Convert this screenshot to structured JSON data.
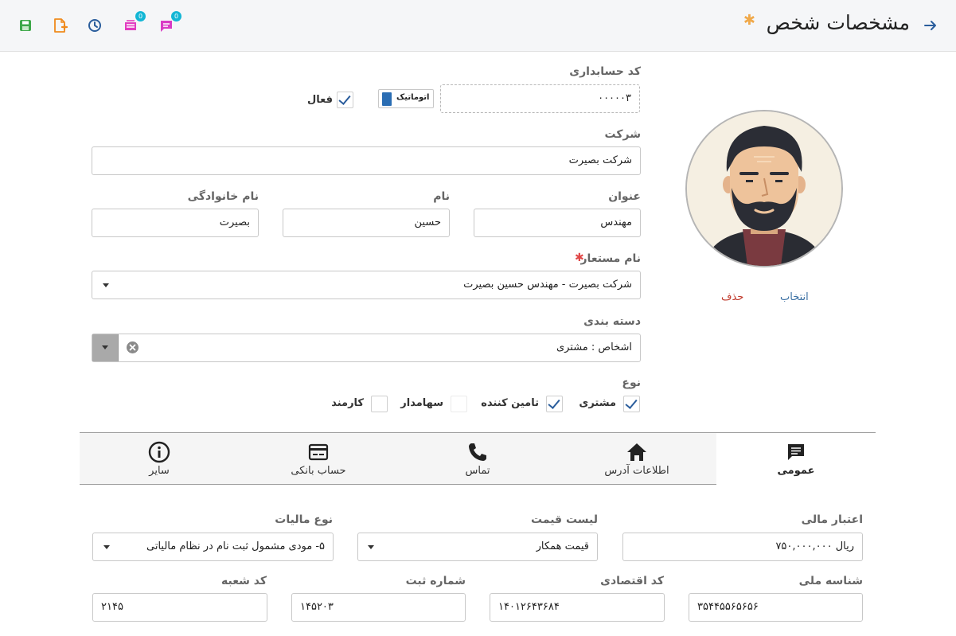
{
  "header": {
    "title": "مشخصات شخص",
    "required_mark": "✱",
    "badge_count_1": "0",
    "badge_count_2": "0"
  },
  "form": {
    "accounting_code_label": "کد حسابداری",
    "accounting_code_value": "۰۰۰۰۰۳",
    "auto_button_label": "اتوماتیک",
    "active_label": "فعال",
    "company_label": "شرکت",
    "company_value": "شرکت بصیرت",
    "title_label": "عنوان",
    "title_value": "مهندس",
    "name_label": "نام",
    "name_value": "حسین",
    "family_label": "نام خانوادگی",
    "family_value": "بصیرت",
    "alias_label": "نام مستعار",
    "alias_required": "✱",
    "alias_value": "شرکت بصیرت - مهندس حسین بصیرت",
    "category_label": "دسته بندی",
    "category_value": "اشخاص : مشتری",
    "type_label": "نوع",
    "types": [
      {
        "label": "مشتری",
        "checked": true
      },
      {
        "label": "تامین کننده",
        "checked": true
      },
      {
        "label": "سهامدار",
        "checked": false
      },
      {
        "label": "کارمند",
        "checked": false
      }
    ]
  },
  "avatar": {
    "select_label": "انتخاب",
    "delete_label": "حذف"
  },
  "tabs": [
    {
      "label": "عمومی",
      "icon": "message-icon",
      "active": true
    },
    {
      "label": "اطلاعات آدرس",
      "icon": "home-icon",
      "active": false
    },
    {
      "label": "تماس",
      "icon": "phone-icon",
      "active": false
    },
    {
      "label": "حساب بانکی",
      "icon": "credit-card-icon",
      "active": false
    },
    {
      "label": "سایر",
      "icon": "info-icon",
      "active": false
    }
  ],
  "general": {
    "credit_label": "اعتبار مالی",
    "credit_value": "ریال ۷۵۰,۰۰۰,۰۰۰",
    "price_list_label": "لیست قیمت",
    "price_list_value": "قیمت همکار",
    "tax_type_label": "نوع مالیات",
    "tax_type_value": "۵- مودی مشمول ثبت نام در نظام مالیاتی",
    "national_id_label": "شناسه ملی",
    "national_id_value": "۳۵۴۴۵۵۶۵۶۵۶",
    "economic_code_label": "کد اقتصادی",
    "economic_code_value": "۱۴۰۱۲۶۴۳۶۸۴",
    "registration_label": "شماره ثبت",
    "registration_value": "۱۴۵۲۰۳",
    "branch_code_label": "کد شعبه",
    "branch_code_value": "۲۱۴۵"
  },
  "colors": {
    "accent": "#2a5d9c",
    "required": "#e04848",
    "title_star": "#f0a94a",
    "delete_link": "#c0392b",
    "badge": "#13b6d5"
  }
}
